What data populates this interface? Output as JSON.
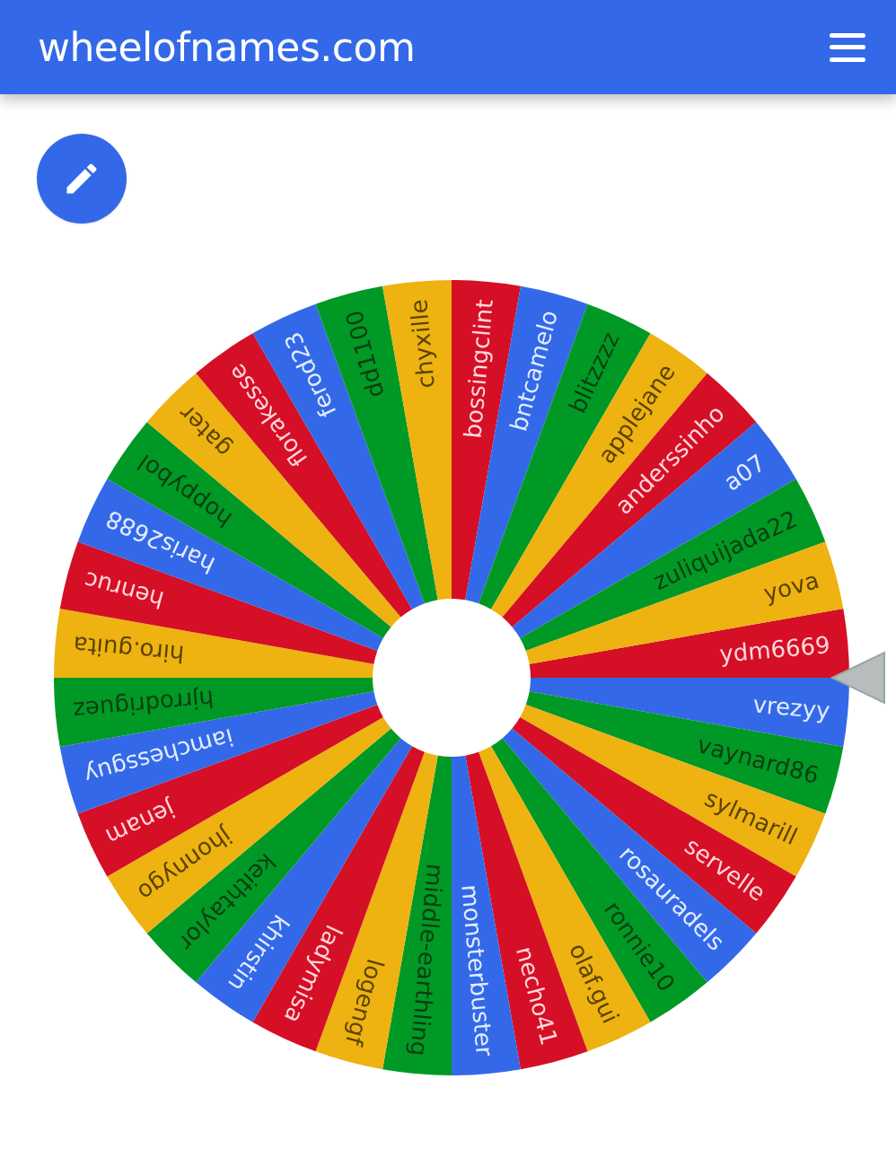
{
  "header": {
    "title": "wheelofnames.com"
  },
  "wheel": {
    "slices": [
      {
        "name": "ydm6669",
        "color": "#d50f25"
      },
      {
        "name": "vrezyy",
        "color": "#3369e8"
      },
      {
        "name": "vaynard86",
        "color": "#009925"
      },
      {
        "name": "sylmarill",
        "color": "#eeb211"
      },
      {
        "name": "servelle",
        "color": "#d50f25"
      },
      {
        "name": "rosauradels",
        "color": "#3369e8"
      },
      {
        "name": "ronnie10",
        "color": "#009925"
      },
      {
        "name": "olaf.gui",
        "color": "#eeb211"
      },
      {
        "name": "necho41",
        "color": "#d50f25"
      },
      {
        "name": "monsterbuster",
        "color": "#3369e8"
      },
      {
        "name": "middle-earthling",
        "color": "#009925"
      },
      {
        "name": "logengf",
        "color": "#eeb211"
      },
      {
        "name": "ladymisa",
        "color": "#d50f25"
      },
      {
        "name": "khirstin",
        "color": "#3369e8"
      },
      {
        "name": "keithtaylor",
        "color": "#009925"
      },
      {
        "name": "jhonnygo",
        "color": "#eeb211"
      },
      {
        "name": "jenam",
        "color": "#d50f25"
      },
      {
        "name": "iamchessguy",
        "color": "#3369e8"
      },
      {
        "name": "hjrrodriguez",
        "color": "#009925"
      },
      {
        "name": "hiro.guita",
        "color": "#eeb211"
      },
      {
        "name": "henruc",
        "color": "#d50f25"
      },
      {
        "name": "haris2688",
        "color": "#3369e8"
      },
      {
        "name": "hoppybol",
        "color": "#009925"
      },
      {
        "name": "gater",
        "color": "#eeb211"
      },
      {
        "name": "florakesse",
        "color": "#d50f25"
      },
      {
        "name": "ferod23",
        "color": "#3369e8"
      },
      {
        "name": "dd1100",
        "color": "#009925"
      },
      {
        "name": "chyxille",
        "color": "#eeb211"
      },
      {
        "name": "bossingclint",
        "color": "#d50f25"
      },
      {
        "name": "bntcamelo",
        "color": "#3369e8"
      },
      {
        "name": "blitzzzz",
        "color": "#009925"
      },
      {
        "name": "applejane",
        "color": "#eeb211"
      },
      {
        "name": "anderssinho",
        "color": "#d50f25"
      },
      {
        "name": "a07",
        "color": "#3369e8"
      },
      {
        "name": "zuliquijada22",
        "color": "#009925"
      },
      {
        "name": "yova",
        "color": "#eeb211"
      }
    ]
  }
}
